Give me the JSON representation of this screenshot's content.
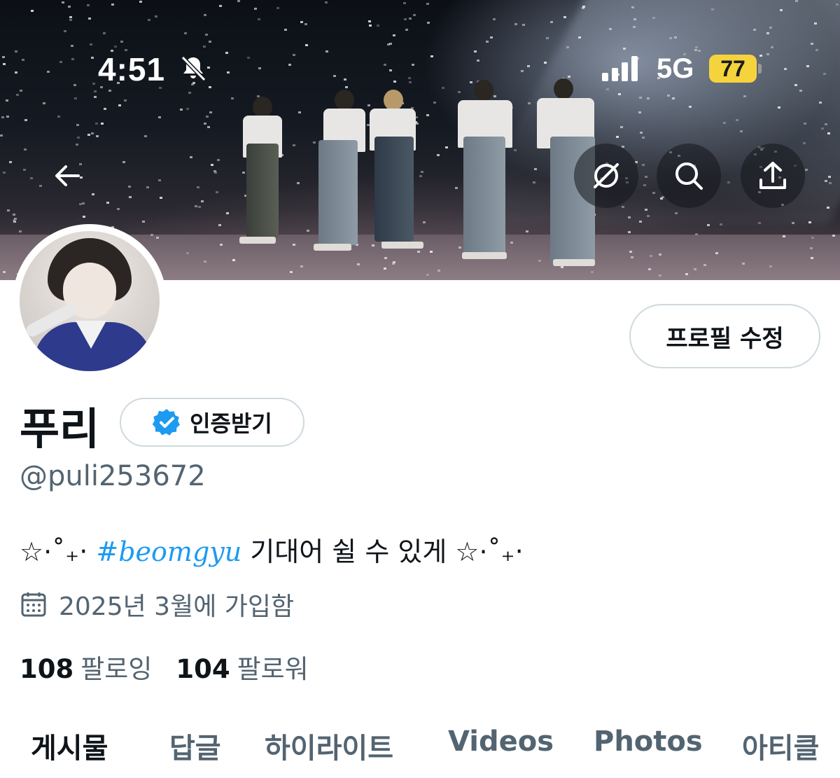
{
  "status_bar": {
    "time": "4:51",
    "network": "5G",
    "battery": "77"
  },
  "header": {
    "back_icon": "arrow-left-icon",
    "grok_icon": "grok-icon",
    "search_icon": "search-icon",
    "share_icon": "share-icon"
  },
  "profile": {
    "edit_label": "프로필 수정",
    "display_name": "푸리",
    "verify_label": "인증받기",
    "handle": "@puli253672",
    "bio": {
      "deco_start": "☆⋅˚₊‧",
      "hashtag": "#beomgyu",
      "text": "기대어 쉴 수 있게",
      "deco_end": "☆⋅˚₊‧"
    },
    "joined": "2025년 3월에 가입함",
    "following_count": "108",
    "following_label": "팔로잉",
    "followers_count": "104",
    "followers_label": "팔로워"
  },
  "tabs": [
    {
      "label": "게시물"
    },
    {
      "label": "답글"
    },
    {
      "label": "하이라이트"
    },
    {
      "label": "Videos"
    },
    {
      "label": "Photos"
    },
    {
      "label": "아티클"
    }
  ],
  "colors": {
    "accent": "#1d9bf0",
    "verified_badge": "#1d9bf0",
    "battery": "#f5d33c",
    "secondary_text": "#536471"
  }
}
